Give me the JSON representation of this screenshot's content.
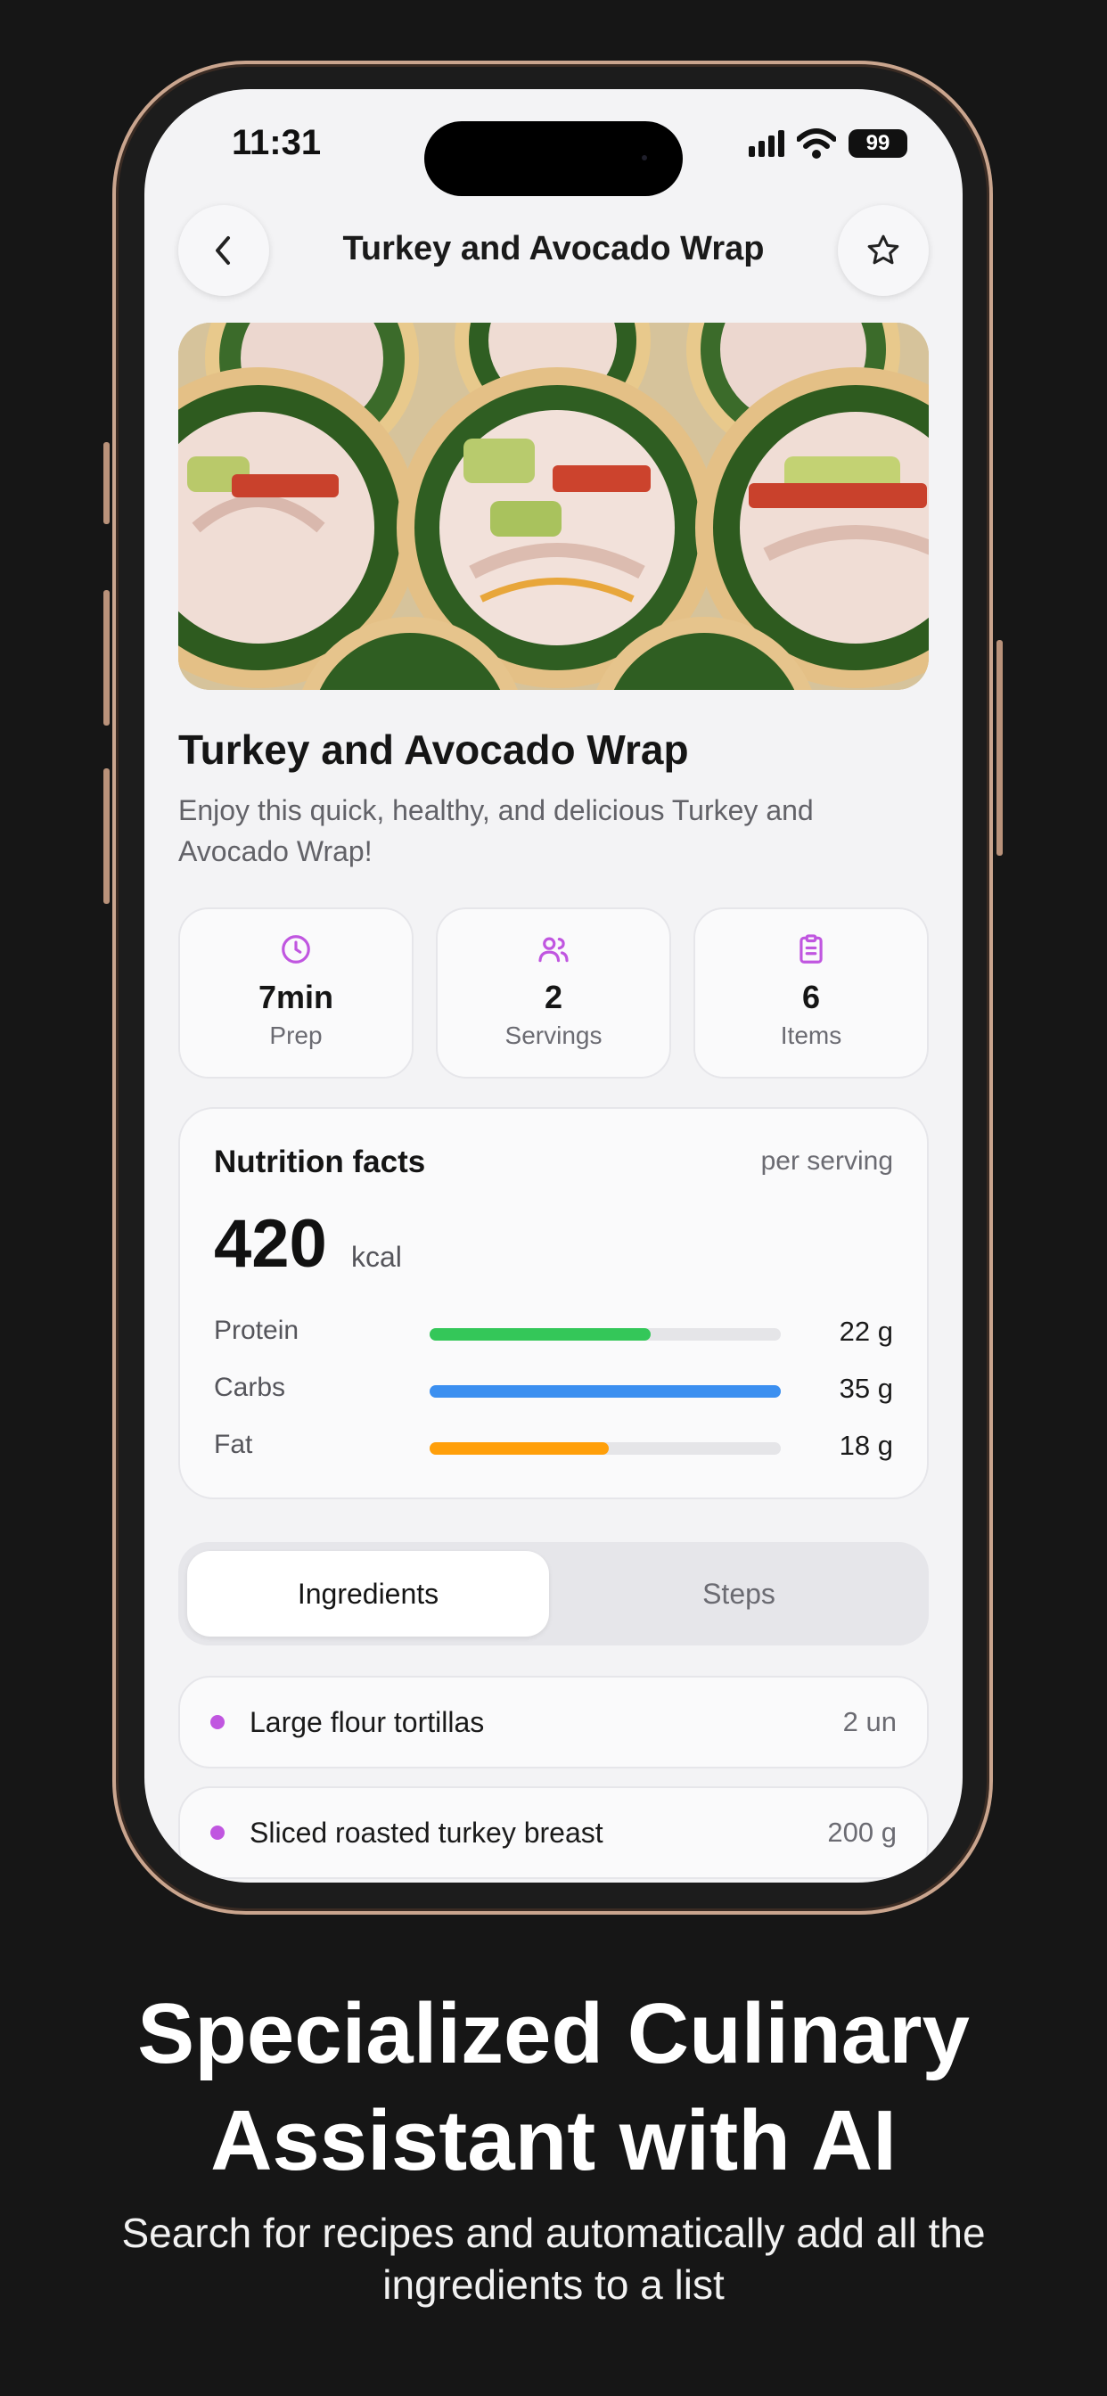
{
  "status_bar": {
    "time": "11:31",
    "battery": "99"
  },
  "header": {
    "title": "Turkey and Avocado Wrap"
  },
  "recipe": {
    "title": "Turkey and Avocado Wrap",
    "description": "Enjoy this quick, healthy, and delicious Turkey and Avocado Wrap!"
  },
  "stats": [
    {
      "icon": "clock-icon",
      "value": "7min",
      "label": "Prep"
    },
    {
      "icon": "users-icon",
      "value": "2",
      "label": "Servings"
    },
    {
      "icon": "clipboard-icon",
      "value": "6",
      "label": "Items"
    }
  ],
  "nutrition": {
    "title": "Nutrition facts",
    "per": "per serving",
    "kcal": "420",
    "kcal_unit": "kcal",
    "macros": [
      {
        "label": "Protein",
        "value": "22 g",
        "fraction": 0.63,
        "color": "#34c759"
      },
      {
        "label": "Carbs",
        "value": "35 g",
        "fraction": 1.0,
        "color": "#3b8ff0"
      },
      {
        "label": "Fat",
        "value": "18 g",
        "fraction": 0.51,
        "color": "#ff9f0a"
      }
    ]
  },
  "tabs": {
    "active": "Ingredients",
    "inactive": "Steps"
  },
  "ingredients": [
    {
      "name": "Large flour tortillas",
      "qty": "2 un"
    },
    {
      "name": "Sliced roasted turkey breast",
      "qty": "200 g"
    }
  ],
  "colors": {
    "accent": "#c056e0",
    "background": "#161616"
  },
  "marketing": {
    "headline_line1": "Specialized Culinary",
    "headline_line2": "Assistant with AI",
    "subheadline": "Search for recipes and automatically add all the ingredients to a list"
  }
}
